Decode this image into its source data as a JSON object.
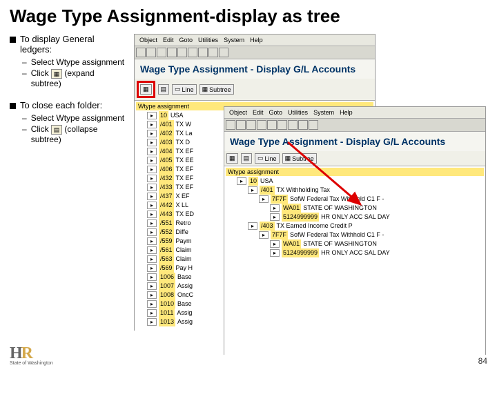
{
  "title": "Wage Type Assignment-display as tree",
  "left_bullets": [
    {
      "text": "To display General ledgers:",
      "subs": [
        {
          "text": "Select Wtype assignment"
        },
        {
          "text_pre": "Click ",
          "icon": "▦",
          "text_post": " (expand subtree)"
        }
      ]
    },
    {
      "text": "To close each folder:",
      "subs": [
        {
          "text": "Select Wtype assignment"
        },
        {
          "text_pre": "Click ",
          "icon": "▤",
          "text_post": " (collapse subtree)"
        }
      ]
    }
  ],
  "menus": [
    "Object",
    "Edit",
    "Goto",
    "Utilities",
    "System",
    "Help"
  ],
  "win1_title": "Wage Type Assignment - Display G/L Accounts",
  "win2_title": "Wage Type Assignment - Display G/L Accounts",
  "toolbar_line": "Line",
  "toolbar_subtree": "Subtree",
  "tree_root": "Wtype assignment",
  "lines1": [
    {
      "i": 1,
      "code": "10",
      "txt": "USA"
    },
    {
      "i": 1,
      "code": "/401",
      "txt": "TX W"
    },
    {
      "i": 1,
      "code": "/402",
      "txt": "TX La"
    },
    {
      "i": 1,
      "code": "/403",
      "txt": "TX D"
    },
    {
      "i": 1,
      "code": "/404",
      "txt": "TX EF"
    },
    {
      "i": 1,
      "code": "/405",
      "txt": "TX EE"
    },
    {
      "i": 1,
      "code": "/406",
      "txt": "TX EF"
    },
    {
      "i": 1,
      "code": "/432",
      "txt": "TX EF"
    },
    {
      "i": 1,
      "code": "/433",
      "txt": "TX EF"
    },
    {
      "i": 1,
      "code": "/437",
      "txt": "X EF"
    },
    {
      "i": 1,
      "code": "/442",
      "txt": "X LL"
    },
    {
      "i": 1,
      "code": "/443",
      "txt": "TX ED"
    },
    {
      "i": 1,
      "code": "/551",
      "txt": "Retro"
    },
    {
      "i": 1,
      "code": "/552",
      "txt": "Diffe"
    },
    {
      "i": 1,
      "code": "/559",
      "txt": "Paym"
    },
    {
      "i": 1,
      "code": "/561",
      "txt": "Claim"
    },
    {
      "i": 1,
      "code": "/563",
      "txt": "Claim"
    },
    {
      "i": 1,
      "code": "/569",
      "txt": "Pay H"
    },
    {
      "i": 1,
      "code": "1006",
      "txt": "Base"
    },
    {
      "i": 1,
      "code": "1007",
      "txt": "Assig"
    },
    {
      "i": 1,
      "code": "1008",
      "txt": "OncC"
    },
    {
      "i": 1,
      "code": "1010",
      "txt": "Base"
    },
    {
      "i": 1,
      "code": "1011",
      "txt": "Assig"
    },
    {
      "i": 1,
      "code": "1013",
      "txt": "Assig"
    }
  ],
  "lines2": [
    {
      "i": 1,
      "code": "10",
      "txt": "USA"
    },
    {
      "i": 2,
      "code": "/401",
      "txt": "TX Withholding Tax"
    },
    {
      "i": 3,
      "code": "7F7F",
      "txt": "SofW Federal Tax Withhold C1 F  -"
    },
    {
      "i": 4,
      "code": "WA01",
      "txt": "STATE OF WASHINGTON"
    },
    {
      "i": 4,
      "code": "5124999999",
      "txt": "HR ONLY ACC SAL DAY"
    },
    {
      "i": 2,
      "code": "/403",
      "txt": "TX Earned Income Credit P"
    },
    {
      "i": 3,
      "code": "7F7F",
      "txt": "SofW Federal Tax Withhold C1 F  -"
    },
    {
      "i": 4,
      "code": "WA01",
      "txt": "STATE OF WASHINGTON"
    },
    {
      "i": 4,
      "code": "5124999999",
      "txt": "HR ONLY ACC SAL DAY"
    }
  ],
  "footer": {
    "brand": "HR",
    "sub": "State of Washington",
    "page": "84"
  }
}
